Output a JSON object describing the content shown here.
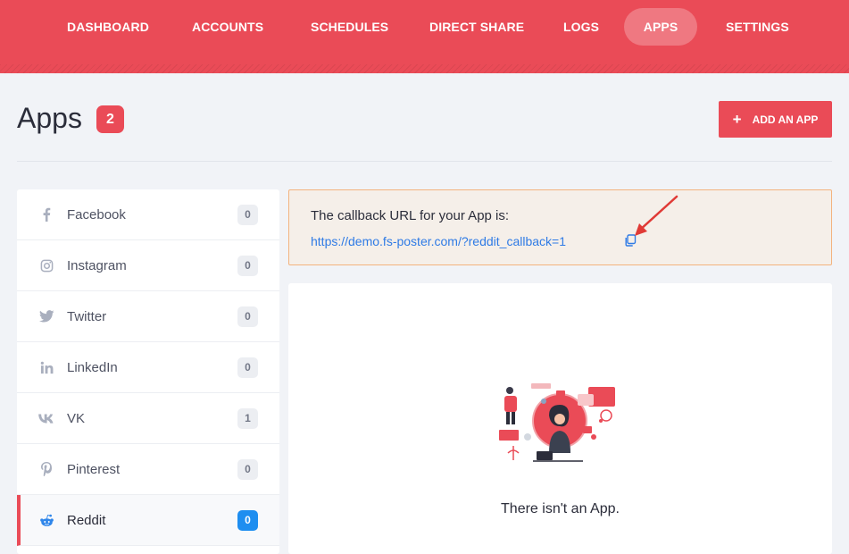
{
  "nav": {
    "items": [
      {
        "label": "DASHBOARD",
        "active": false
      },
      {
        "label": "ACCOUNTS",
        "active": false
      },
      {
        "label": "SCHEDULES",
        "active": false
      },
      {
        "label": "DIRECT SHARE",
        "active": false
      },
      {
        "label": "LOGS",
        "active": false
      },
      {
        "label": "APPS",
        "active": true
      },
      {
        "label": "SETTINGS",
        "active": false
      }
    ]
  },
  "header": {
    "title": "Apps",
    "count": "2",
    "add_button_label": "ADD AN APP"
  },
  "sidebar": {
    "items": [
      {
        "label": "Facebook",
        "count": "0",
        "icon": "facebook-icon"
      },
      {
        "label": "Instagram",
        "count": "0",
        "icon": "instagram-icon"
      },
      {
        "label": "Twitter",
        "count": "0",
        "icon": "twitter-icon"
      },
      {
        "label": "LinkedIn",
        "count": "0",
        "icon": "linkedin-icon"
      },
      {
        "label": "VK",
        "count": "1",
        "icon": "vk-icon"
      },
      {
        "label": "Pinterest",
        "count": "0",
        "icon": "pinterest-icon"
      },
      {
        "label": "Reddit",
        "count": "0",
        "icon": "reddit-icon",
        "active": true
      }
    ]
  },
  "callback": {
    "title": "The callback URL for your App is:",
    "url": "https://demo.fs-poster.com/?reddit_callback=1"
  },
  "empty_state": {
    "message": "There isn't an App."
  },
  "colors": {
    "brand": "#ea4b57",
    "link": "#2f7be5",
    "active_count": "#1e8ef0",
    "notice_border": "#f3b37e"
  }
}
